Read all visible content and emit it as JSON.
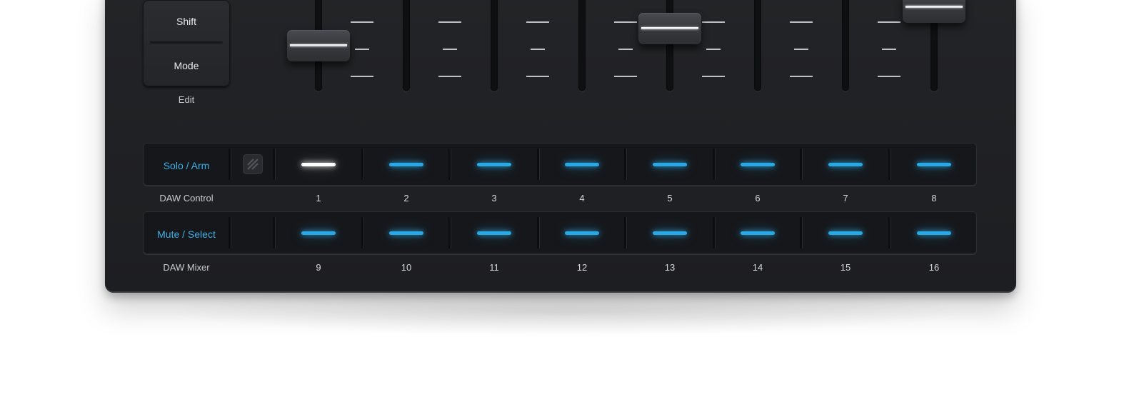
{
  "edit_block": {
    "shift_label": "Shift",
    "mode_label": "Mode",
    "caption": "Edit"
  },
  "faders": {
    "count": 8,
    "cap_values": [
      0.55,
      null,
      null,
      null,
      0.75,
      null,
      null,
      1.0
    ]
  },
  "row1": {
    "button_label": "Solo / Arm",
    "caption": "DAW Control",
    "logo_icon": "focusrite-logo-icon",
    "pads": [
      {
        "number": "1",
        "led_color": "#ffffff"
      },
      {
        "number": "2",
        "led_color": "#2aa8e6"
      },
      {
        "number": "3",
        "led_color": "#2aa8e6"
      },
      {
        "number": "4",
        "led_color": "#2aa8e6"
      },
      {
        "number": "5",
        "led_color": "#2aa8e6"
      },
      {
        "number": "6",
        "led_color": "#2aa8e6"
      },
      {
        "number": "7",
        "led_color": "#2aa8e6"
      },
      {
        "number": "8",
        "led_color": "#2aa8e6"
      }
    ]
  },
  "row2": {
    "button_label": "Mute / Select",
    "caption": "DAW Mixer",
    "pads": [
      {
        "number": "9",
        "led_color": "#2aa8e6"
      },
      {
        "number": "10",
        "led_color": "#2aa8e6"
      },
      {
        "number": "11",
        "led_color": "#2aa8e6"
      },
      {
        "number": "12",
        "led_color": "#2aa8e6"
      },
      {
        "number": "13",
        "led_color": "#2aa8e6"
      },
      {
        "number": "14",
        "led_color": "#2aa8e6"
      },
      {
        "number": "15",
        "led_color": "#2aa8e6"
      },
      {
        "number": "16",
        "led_color": "#2aa8e6"
      }
    ]
  },
  "colors": {
    "accent_blue": "#3fb0e6",
    "led_blue": "#2aa8e6",
    "led_white": "#ffffff",
    "device_body": "#1f2023"
  }
}
